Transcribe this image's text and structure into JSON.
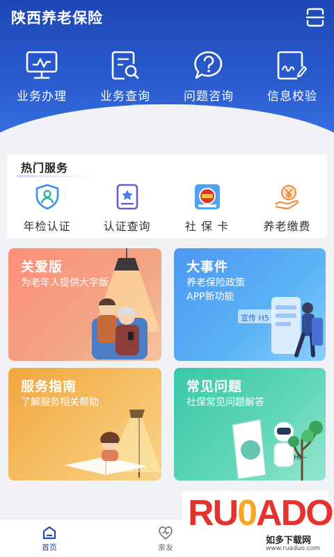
{
  "header": {
    "title": "陕西养老保险",
    "quick_actions": [
      {
        "label": "业务办理",
        "icon": "monitor-chart-icon"
      },
      {
        "label": "业务查询",
        "icon": "document-search-icon"
      },
      {
        "label": "问题咨询",
        "icon": "question-bubble-icon"
      },
      {
        "label": "信息校验",
        "icon": "signature-check-icon"
      }
    ]
  },
  "hot_services": {
    "title": "热门服务",
    "items": [
      {
        "label": "年检认证",
        "icon": "shield-person-icon"
      },
      {
        "label": "认证查询",
        "icon": "certificate-star-icon"
      },
      {
        "label": "社 保 卡",
        "icon": "social-security-card-icon"
      },
      {
        "label": "养老缴费",
        "icon": "yuan-hand-icon"
      }
    ]
  },
  "cards": {
    "care": {
      "title": "关爱版",
      "subtitle": "为老年人提供大字版"
    },
    "events": {
      "title": "大事件",
      "subtitle_line1": "养老保险政策",
      "subtitle_line2": "APP新功能",
      "badge": "宣传 H5"
    },
    "guide": {
      "title": "服务指南",
      "subtitle": "了解服务相关帮助"
    },
    "faq": {
      "title": "常见问题",
      "subtitle": "社保常见问题解答",
      "robot_text": "Hi~"
    }
  },
  "bottom_nav": [
    {
      "label": "首页",
      "active": true
    },
    {
      "label": "亲友",
      "active": false
    }
  ],
  "watermark": {
    "brand_ru": "RU",
    "brand_o": "0",
    "brand_ado": "ADO",
    "cn": "如多下载网",
    "url": "www.ruaduo.com"
  },
  "colors": {
    "header_blue": "#1e47b6",
    "care_card": "#f1a585",
    "events_card": "#5ab3f5",
    "guide_card": "#f6c26a",
    "faq_card": "#62d7b9"
  }
}
